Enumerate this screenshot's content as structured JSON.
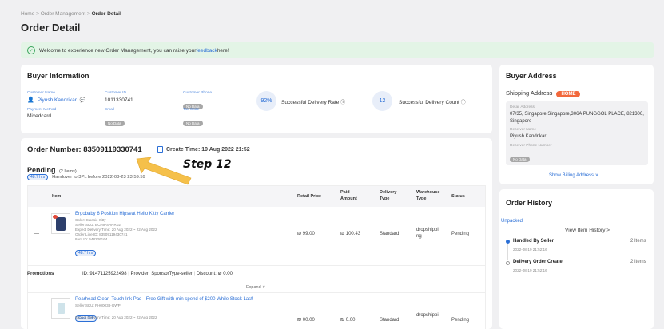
{
  "breadcrumb": {
    "home": "Home",
    "sep": ">",
    "order_mgmt": "Order Management",
    "current": "Order Detail"
  },
  "page_title": "Order Detail",
  "banner": {
    "text": "Welcome to experience new Order Management, you can raise your ",
    "link": "feedback",
    "suffix": " here!"
  },
  "buyer_info": {
    "title": "Buyer Information",
    "customer_name_label": "Customer Name",
    "customer_name": "Piyush Kandrikar",
    "customer_id_label": "Customer ID",
    "customer_id": "1011330741",
    "customer_phone_label": "Customer Phone",
    "no_data": "No Data",
    "payment_method_label": "Payment Method",
    "payment_method": "Mixedcard",
    "email_label": "Email",
    "tax_code_label": "Tax Code",
    "delivery_rate": "92%",
    "delivery_rate_label": "Successful Delivery Rate",
    "delivery_count": "12",
    "delivery_count_label": "Successful Delivery Count"
  },
  "buyer_address": {
    "title": "Buyer Address",
    "shipping_label": "Shipping Address",
    "home_badge": "HOME",
    "detail_label": "Detail Address",
    "detail": "07/35, Singapore,Singapore,306A PUNGGOL PLACE, 821306, Singapore",
    "receiver_name_label": "Receiver Name",
    "receiver_name": "Piyush Kandrikar",
    "receiver_phone_label": "Receiver Phone Number",
    "no_data": "No Data",
    "billing_link": "Show Billing Address ∨"
  },
  "order": {
    "number_label": "Order Number: 83509119330741",
    "create_time": "Create Time: 19 Aug 2022 21:52",
    "status": "Pending",
    "items_count": "(2 Items)",
    "hours_tag": "48.7 hrs",
    "handover": "Handover to 3PL before 2022-08-23 23:59:59"
  },
  "annotation": {
    "step": "Step 12"
  },
  "table": {
    "headers": [
      "Item",
      "Retail Price",
      "Paid Amount",
      "Delivery Type",
      "Warehouse Type",
      "Status"
    ],
    "row1": {
      "dash": "—",
      "name": "Ergobaby 6 Position Hipseat Hello Kitty Carrier",
      "color": "Color: Classic Kitty",
      "sku": "Seller SKU: BCHIPSANR02",
      "expect": "Expect Delivery Time: 20 Aug 2022 ~ 22 Aug 2022",
      "line_id": "Order Line ID: 83509119430741",
      "item_id": "Item ID: 548226164",
      "hours": "48.7 hrs",
      "retail": "₪ 99.00",
      "paid": "₪ 100.43",
      "delivery": "Standard",
      "warehouse": "dropshipping",
      "status": "Pending"
    },
    "promotion": {
      "label": "Promotions",
      "id": "ID: 91471125922498",
      "provider": "Provider: SponsorType-seller",
      "discount": "Discount: ₪ 0.00",
      "expand": "Expand ∨"
    },
    "row2": {
      "name": "Pearhead Clean-Touch Ink Pad - Free Gift with min spend of $200 While Stock Last!",
      "sku": "Seller SKU: PH00038-GWP",
      "gift": "Free Gift",
      "expect": "Expect Delivery Time: 20 Aug 2022 ~ 22 Aug 2022",
      "retail": "₪ 00.00",
      "paid": "₪ 0.00",
      "delivery": "Standard",
      "warehouse": "dropshippi",
      "status": "Pending"
    }
  },
  "history": {
    "title": "Order History",
    "unpacked": "Unpacked",
    "view_link": "View Item History >",
    "e1_title": "Handled By Seller",
    "e1_time": "2022-08-19 21:52:16",
    "e1_count": "2 Items",
    "e2_title": "Delivery Order Create",
    "e2_time": "2022-08-19 21:52:16",
    "e2_count": "2 Items"
  },
  "colors": {
    "accent": "#2b6fd6",
    "home_badge": "#f2683c",
    "banner_bg": "#e3f4e6",
    "arrow": "#f5c04a"
  }
}
